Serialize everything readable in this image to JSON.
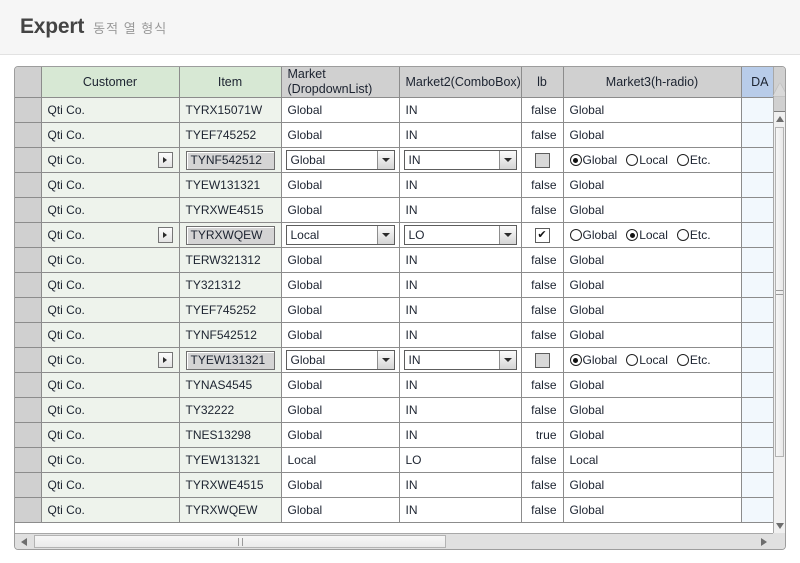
{
  "titlebar": {
    "main": "Expert",
    "sub": "동적 열 형식"
  },
  "grid": {
    "columns": [
      {
        "key": "rowhdr",
        "label": "",
        "align": "center",
        "style": "rowhdr"
      },
      {
        "key": "customer",
        "label": "Customer",
        "align": "center",
        "style": "green"
      },
      {
        "key": "item",
        "label": "Item",
        "align": "center",
        "style": "green"
      },
      {
        "key": "market",
        "label": "Market\n(DropdownList)",
        "align": "left",
        "style": "gray"
      },
      {
        "key": "market2",
        "label": "Market2(ComboBox)",
        "align": "center",
        "style": "gray"
      },
      {
        "key": "lb",
        "label": "lb",
        "align": "center",
        "style": "gray"
      },
      {
        "key": "market3",
        "label": "Market3(h-radio)",
        "align": "center",
        "style": "gray"
      },
      {
        "key": "da",
        "label": "DA",
        "align": "right",
        "style": "blue"
      }
    ],
    "header_labels": {
      "customer": "Customer",
      "item": "Item",
      "market_line1": "Market",
      "market_line2": "(DropdownList)",
      "market2": "Market2(ComboBox)",
      "lb": "lb",
      "market3": "Market3(h-radio)",
      "da": "DA"
    },
    "radio_options": [
      "Global",
      "Local",
      "Etc."
    ],
    "rows": [
      {
        "mode": "view",
        "customer": "Qti Co.",
        "item": "TYRX15071W",
        "market": "Global",
        "market2": "IN",
        "lb": "false",
        "market3": "Global",
        "da": ""
      },
      {
        "mode": "view",
        "customer": "Qti Co.",
        "item": "TYEF745252",
        "market": "Global",
        "market2": "IN",
        "lb": "false",
        "market3": "Global",
        "da": ""
      },
      {
        "mode": "edit",
        "customer": "Qti Co.",
        "item": "TYNF542512",
        "market": "Global",
        "market2": "IN",
        "lb": "false",
        "market3": "Global",
        "da": ""
      },
      {
        "mode": "view",
        "customer": "Qti Co.",
        "item": "TYEW131321",
        "market": "Global",
        "market2": "IN",
        "lb": "false",
        "market3": "Global",
        "da": ""
      },
      {
        "mode": "view",
        "customer": "Qti Co.",
        "item": "TYRXWE4515",
        "market": "Global",
        "market2": "IN",
        "lb": "false",
        "market3": "Global",
        "da": ""
      },
      {
        "mode": "edit",
        "customer": "Qti Co.",
        "item": "TYRXWQEW",
        "market": "Local",
        "market2": "LO",
        "lb": "true",
        "market3": "Local",
        "da": ""
      },
      {
        "mode": "view",
        "customer": "Qti Co.",
        "item": "TERW321312",
        "market": "Global",
        "market2": "IN",
        "lb": "false",
        "market3": "Global",
        "da": ""
      },
      {
        "mode": "view",
        "customer": "Qti Co.",
        "item": "TY321312",
        "market": "Global",
        "market2": "IN",
        "lb": "false",
        "market3": "Global",
        "da": ""
      },
      {
        "mode": "view",
        "customer": "Qti Co.",
        "item": "TYEF745252",
        "market": "Global",
        "market2": "IN",
        "lb": "false",
        "market3": "Global",
        "da": ""
      },
      {
        "mode": "view",
        "customer": "Qti Co.",
        "item": "TYNF542512",
        "market": "Global",
        "market2": "IN",
        "lb": "false",
        "market3": "Global",
        "da": ""
      },
      {
        "mode": "edit",
        "customer": "Qti Co.",
        "item": "TYEW131321",
        "market": "Global",
        "market2": "IN",
        "lb": "false",
        "market3": "Global",
        "da": ""
      },
      {
        "mode": "view",
        "customer": "Qti Co.",
        "item": "TYNAS4545",
        "market": "Global",
        "market2": "IN",
        "lb": "false",
        "market3": "Global",
        "da": ""
      },
      {
        "mode": "view",
        "customer": "Qti Co.",
        "item": "TY32222",
        "market": "Global",
        "market2": "IN",
        "lb": "false",
        "market3": "Global",
        "da": ""
      },
      {
        "mode": "view",
        "customer": "Qti Co.",
        "item": "TNES13298",
        "market": "Global",
        "market2": "IN",
        "lb": "true",
        "market3": "Global",
        "da": ""
      },
      {
        "mode": "view",
        "customer": "Qti Co.",
        "item": "TYEW131321",
        "market": "Local",
        "market2": "LO",
        "lb": "false",
        "market3": "Local",
        "da": ""
      },
      {
        "mode": "view",
        "customer": "Qti Co.",
        "item": "TYRXWE4515",
        "market": "Global",
        "market2": "IN",
        "lb": "false",
        "market3": "Global",
        "da": ""
      },
      {
        "mode": "view",
        "customer": "Qti Co.",
        "item": "TYRXWQEW",
        "market": "Global",
        "market2": "IN",
        "lb": "false",
        "market3": "Global",
        "da": ""
      }
    ]
  },
  "colors": {
    "header_green": "#d7e8d4",
    "header_gray": "#d0d0d0",
    "header_blue": "#b8cce9",
    "row_pale_green": "#eef3ec",
    "da_cell": "#f2f8fd",
    "title_text": "#444444",
    "subtitle_text": "#9a9a9a"
  },
  "icons": {
    "expand_row": "caret-right-icon",
    "dropdown": "caret-down-icon",
    "checkmark": "✔",
    "scroll_up": "caret-up-icon",
    "scroll_down": "caret-down-icon",
    "scroll_left": "caret-left-icon",
    "scroll_right": "caret-right-icon"
  }
}
